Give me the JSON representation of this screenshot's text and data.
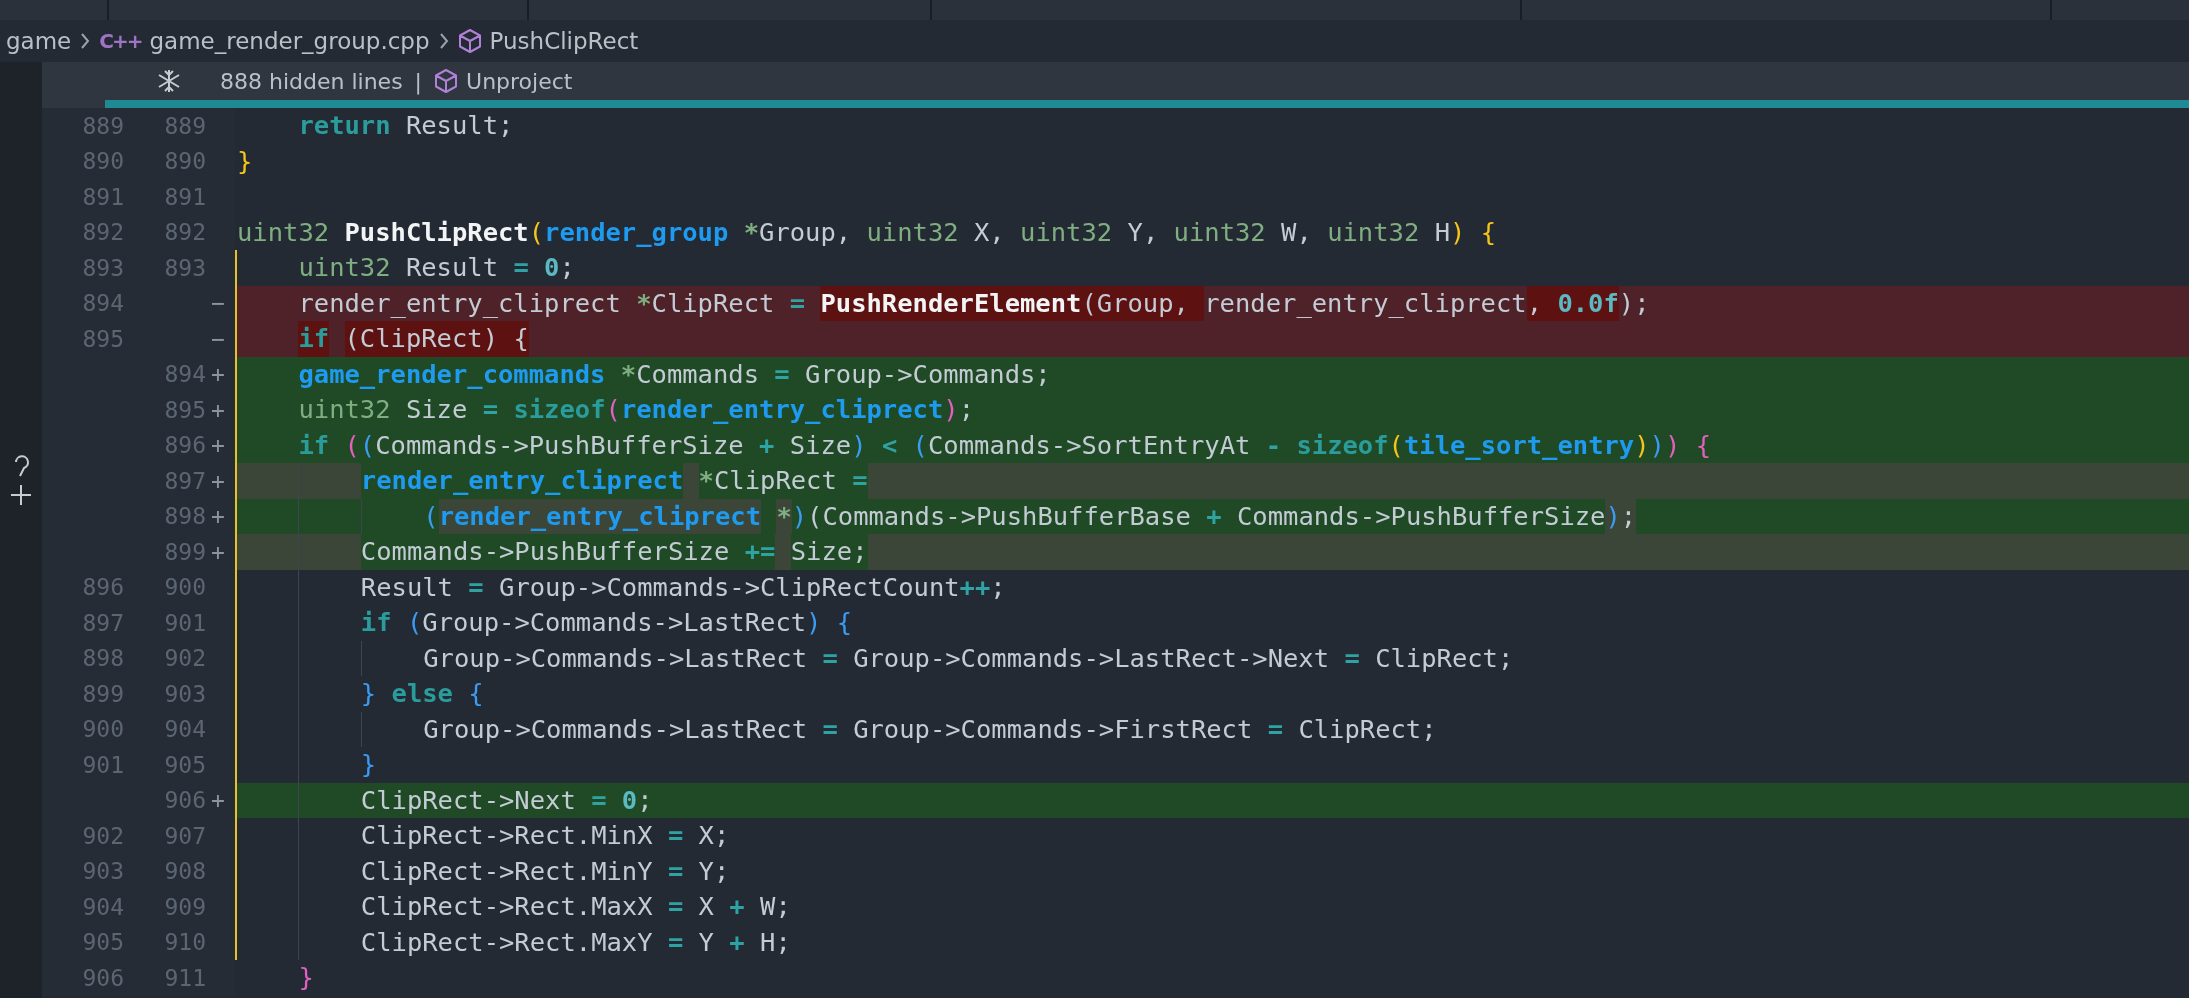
{
  "breadcrumb": [
    {
      "kind": "folder",
      "text": "game"
    },
    {
      "kind": "file",
      "icon_text": "C++",
      "text": "game_render_group.cpp"
    },
    {
      "kind": "symbol",
      "text": "PushClipRect"
    }
  ],
  "fold_bar": {
    "hidden": "888 hidden lines",
    "separator": "|",
    "scope": "Unproject"
  },
  "lines": [
    {
      "old": "889",
      "new": "889",
      "kind": "context",
      "in_scope": false,
      "tokens": [
        {
          "text": "    return",
          "kind": "kw"
        },
        {
          "text": " Result;",
          "kind": "id"
        }
      ]
    },
    {
      "old": "890",
      "new": "890",
      "kind": "context",
      "in_scope": false,
      "tokens": [
        {
          "text": "}",
          "kind": "b1"
        }
      ]
    },
    {
      "old": "891",
      "new": "891",
      "kind": "context",
      "in_scope": false
    },
    {
      "old": "892",
      "new": "892",
      "kind": "context",
      "in_scope": false,
      "tokens": [
        {
          "text": "uint32",
          "kind": "type"
        },
        {
          "text": " PushClipRect",
          "kind": "fn"
        },
        {
          "text": "(",
          "kind": "b1"
        },
        {
          "text": "render_group",
          "kind": "utype"
        },
        {
          "text": " *",
          "kind": "ptr"
        },
        {
          "text": "Group, ",
          "kind": "id"
        },
        {
          "text": "uint32",
          "kind": "type"
        },
        {
          "text": " X, ",
          "kind": "id"
        },
        {
          "text": "uint32",
          "kind": "type"
        },
        {
          "text": " Y, ",
          "kind": "id"
        },
        {
          "text": "uint32",
          "kind": "type"
        },
        {
          "text": " W, ",
          "kind": "id"
        },
        {
          "text": "uint32",
          "kind": "type"
        },
        {
          "text": " H",
          "kind": "id"
        },
        {
          "text": ")",
          "kind": "b1"
        },
        {
          "text": " {",
          "kind": "b1"
        }
      ]
    },
    {
      "old": "893",
      "new": "893",
      "kind": "context",
      "in_scope": true,
      "tokens": [
        {
          "text": "    uint32",
          "kind": "type"
        },
        {
          "text": " Result ",
          "kind": "id"
        },
        {
          "text": "=",
          "kind": "op"
        },
        {
          "text": " 0",
          "kind": "num"
        },
        {
          "text": ";",
          "kind": "id"
        }
      ]
    },
    {
      "old": "894",
      "marker": "−",
      "kind": "removed",
      "in_scope": true,
      "tokens": [
        {
          "text": "    render_entry_cliprect ",
          "kind": "id",
          "changed": false
        },
        {
          "text": "*",
          "kind": "ptr",
          "changed": false
        },
        {
          "text": "ClipRect ",
          "kind": "id",
          "changed": false
        },
        {
          "text": "=",
          "kind": "op",
          "changed": false
        },
        {
          "text": " PushRenderElement",
          "kind": "fn",
          "changed": true
        },
        {
          "text": "(Group, ",
          "kind": "id",
          "changed": true
        },
        {
          "text": "render_entry_cliprect",
          "kind": "id",
          "changed": false
        },
        {
          "text": ", ",
          "kind": "id",
          "changed": true
        },
        {
          "text": "0.0f",
          "kind": "num",
          "changed": true
        },
        {
          "text": ");",
          "kind": "id",
          "changed": false
        }
      ]
    },
    {
      "old": "895",
      "marker": "−",
      "kind": "removed",
      "in_scope": true,
      "tokens": [
        {
          "text": "    if",
          "kind": "kw",
          "changed": true
        },
        {
          "text": " (ClipRect) {",
          "kind": "id",
          "changed": true
        }
      ]
    },
    {
      "new": "894",
      "marker": "+",
      "kind": "added",
      "in_scope": true,
      "tokens": [
        {
          "text": "    game_render_commands",
          "kind": "utype"
        },
        {
          "text": " *",
          "kind": "ptr"
        },
        {
          "text": "Commands ",
          "kind": "id"
        },
        {
          "text": "=",
          "kind": "op"
        },
        {
          "text": " Group->Commands;",
          "kind": "id"
        }
      ]
    },
    {
      "new": "895",
      "marker": "+",
      "kind": "added",
      "in_scope": true,
      "tokens": [
        {
          "text": "    uint32",
          "kind": "type"
        },
        {
          "text": " Size ",
          "kind": "id"
        },
        {
          "text": "=",
          "kind": "op"
        },
        {
          "text": " sizeof",
          "kind": "kw"
        },
        {
          "text": "(",
          "kind": "b3"
        },
        {
          "text": "render_entry_cliprect",
          "kind": "utype"
        },
        {
          "text": ")",
          "kind": "b3"
        },
        {
          "text": ";",
          "kind": "id"
        }
      ]
    },
    {
      "new": "896",
      "marker": "+",
      "kind": "added",
      "in_scope": true,
      "tokens": [
        {
          "text": "    if",
          "kind": "kw"
        },
        {
          "text": " (",
          "kind": "b3"
        },
        {
          "text": "(",
          "kind": "b2"
        },
        {
          "text": "Commands->PushBufferSize ",
          "kind": "id"
        },
        {
          "text": "+",
          "kind": "op"
        },
        {
          "text": " Size",
          "kind": "id"
        },
        {
          "text": ")",
          "kind": "b2"
        },
        {
          "text": " <",
          "kind": "op"
        },
        {
          "text": " (",
          "kind": "b2"
        },
        {
          "text": "Commands->SortEntryAt ",
          "kind": "id"
        },
        {
          "text": "-",
          "kind": "op"
        },
        {
          "text": " sizeof",
          "kind": "kw"
        },
        {
          "text": "(",
          "kind": "b1"
        },
        {
          "text": "tile_sort_entry",
          "kind": "utype"
        },
        {
          "text": ")",
          "kind": "b1"
        },
        {
          "text": ")",
          "kind": "b2"
        },
        {
          "text": ")",
          "kind": "b3"
        },
        {
          "text": " {",
          "kind": "b3"
        }
      ]
    },
    {
      "new": "897",
      "marker": "+",
      "kind": "moved",
      "in_scope": true,
      "tokens": [
        {
          "text": "        render_entry_cliprect",
          "kind": "utype",
          "changed": true
        },
        {
          "text": " *",
          "kind": "ptr",
          "changed": true
        },
        {
          "text": "ClipRect ",
          "kind": "id",
          "changed": true
        },
        {
          "text": "=",
          "kind": "op",
          "changed": true
        }
      ]
    },
    {
      "new": "898",
      "marker": "+",
      "kind": "added",
      "in_scope": true,
      "tokens": [
        {
          "text": "            (",
          "kind": "b2",
          "changed": false
        },
        {
          "text": "render_entry_cliprect",
          "kind": "utype",
          "changed": true
        },
        {
          "text": " *",
          "kind": "ptr",
          "changed": true
        },
        {
          "text": ")",
          "kind": "b2",
          "changed": false
        },
        {
          "text": "(Commands->PushBufferBase ",
          "kind": "id",
          "changed": false
        },
        {
          "text": "+",
          "kind": "op",
          "changed": false
        },
        {
          "text": " Commands->PushBufferSize",
          "kind": "id",
          "changed": false
        },
        {
          "text": ")",
          "kind": "b2",
          "changed": true
        },
        {
          "text": ";",
          "kind": "id",
          "changed": true
        }
      ]
    },
    {
      "new": "899",
      "marker": "+",
      "kind": "moved",
      "in_scope": true,
      "tokens": [
        {
          "text": "        Commands->PushBufferSize ",
          "kind": "id",
          "changed": true
        },
        {
          "text": "+=",
          "kind": "op",
          "changed": true
        },
        {
          "text": " Size;",
          "kind": "id",
          "changed": true
        }
      ]
    },
    {
      "old": "896",
      "new": "900",
      "kind": "context",
      "in_scope": true,
      "tokens": [
        {
          "text": "        Result ",
          "kind": "id"
        },
        {
          "text": "=",
          "kind": "op"
        },
        {
          "text": " Group->Commands->ClipRectCount",
          "kind": "id"
        },
        {
          "text": "++",
          "kind": "op"
        },
        {
          "text": ";",
          "kind": "id"
        }
      ]
    },
    {
      "old": "897",
      "new": "901",
      "kind": "context",
      "in_scope": true,
      "tokens": [
        {
          "text": "        if",
          "kind": "kw"
        },
        {
          "text": " (",
          "kind": "b2"
        },
        {
          "text": "Group->Commands->LastRect",
          "kind": "id"
        },
        {
          "text": ")",
          "kind": "b2"
        },
        {
          "text": " {",
          "kind": "b2"
        }
      ]
    },
    {
      "old": "898",
      "new": "902",
      "kind": "context",
      "in_scope": true,
      "tokens": [
        {
          "text": "            Group->Commands->LastRect ",
          "kind": "id"
        },
        {
          "text": "=",
          "kind": "op"
        },
        {
          "text": " Group->Commands->LastRect->Next ",
          "kind": "id"
        },
        {
          "text": "=",
          "kind": "op"
        },
        {
          "text": " ClipRect;",
          "kind": "id"
        }
      ]
    },
    {
      "old": "899",
      "new": "903",
      "kind": "context",
      "in_scope": true,
      "tokens": [
        {
          "text": "        }",
          "kind": "b2"
        },
        {
          "text": " else",
          "kind": "kw"
        },
        {
          "text": " {",
          "kind": "b2"
        }
      ]
    },
    {
      "old": "900",
      "new": "904",
      "kind": "context",
      "in_scope": true,
      "tokens": [
        {
          "text": "            Group->Commands->LastRect ",
          "kind": "id"
        },
        {
          "text": "=",
          "kind": "op"
        },
        {
          "text": " Group->Commands->FirstRect ",
          "kind": "id"
        },
        {
          "text": "=",
          "kind": "op"
        },
        {
          "text": " ClipRect;",
          "kind": "id"
        }
      ]
    },
    {
      "old": "901",
      "new": "905",
      "kind": "context",
      "in_scope": true,
      "tokens": [
        {
          "text": "        }",
          "kind": "b2"
        }
      ]
    },
    {
      "new": "906",
      "marker": "+",
      "kind": "added",
      "in_scope": true,
      "tokens": [
        {
          "text": "        ClipRect->Next ",
          "kind": "id"
        },
        {
          "text": "=",
          "kind": "op"
        },
        {
          "text": " 0",
          "kind": "num"
        },
        {
          "text": ";",
          "kind": "id"
        }
      ]
    },
    {
      "old": "902",
      "new": "907",
      "kind": "context",
      "in_scope": true,
      "tokens": [
        {
          "text": "        ClipRect->Rect.MinX ",
          "kind": "id"
        },
        {
          "text": "=",
          "kind": "op"
        },
        {
          "text": " X;",
          "kind": "id"
        }
      ]
    },
    {
      "old": "903",
      "new": "908",
      "kind": "context",
      "in_scope": true,
      "tokens": [
        {
          "text": "        ClipRect->Rect.MinY ",
          "kind": "id"
        },
        {
          "text": "=",
          "kind": "op"
        },
        {
          "text": " Y;",
          "kind": "id"
        }
      ]
    },
    {
      "old": "904",
      "new": "909",
      "kind": "context",
      "in_scope": true,
      "tokens": [
        {
          "text": "        ClipRect->Rect.MaxX ",
          "kind": "id"
        },
        {
          "text": "=",
          "kind": "op"
        },
        {
          "text": " X ",
          "kind": "id"
        },
        {
          "text": "+",
          "kind": "op"
        },
        {
          "text": " W;",
          "kind": "id"
        }
      ]
    },
    {
      "old": "905",
      "new": "910",
      "kind": "context",
      "in_scope": true,
      "tokens": [
        {
          "text": "        ClipRect->Rect.MaxY ",
          "kind": "id"
        },
        {
          "text": "=",
          "kind": "op"
        },
        {
          "text": " Y ",
          "kind": "id"
        },
        {
          "text": "+",
          "kind": "op"
        },
        {
          "text": " H;",
          "kind": "id"
        }
      ]
    },
    {
      "old": "906",
      "new": "911",
      "kind": "context",
      "in_scope": false,
      "tokens": [
        {
          "text": "    }",
          "kind": "b3"
        }
      ]
    }
  ]
}
